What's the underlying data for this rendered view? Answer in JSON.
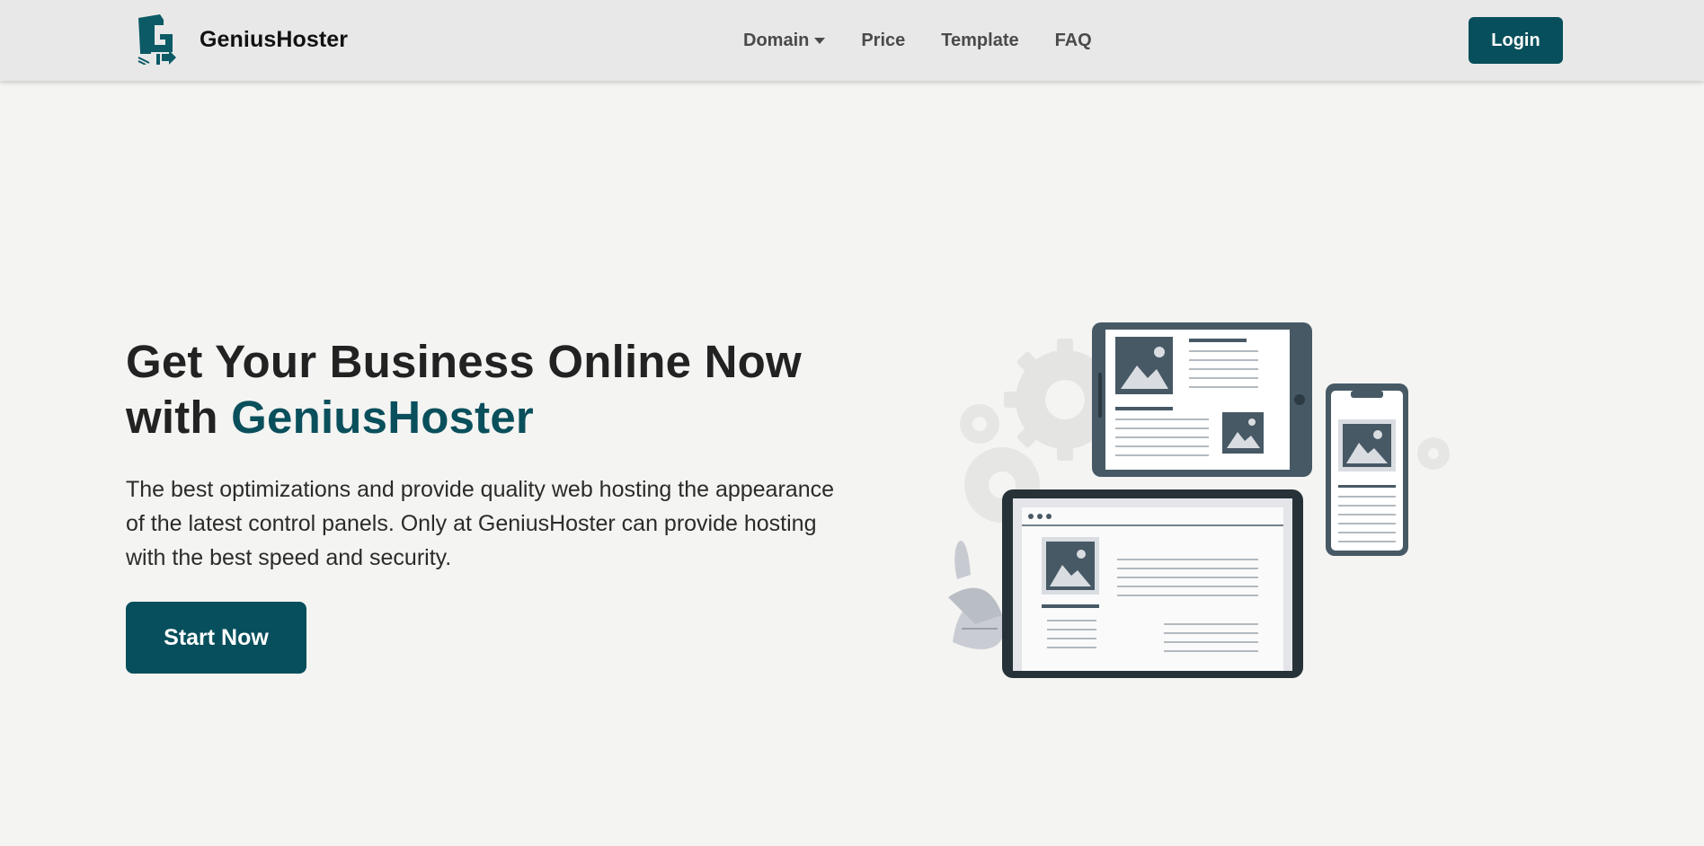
{
  "brand": {
    "name": "GeniusHoster"
  },
  "nav": {
    "items": [
      {
        "label": "Domain",
        "has_dropdown": true
      },
      {
        "label": "Price"
      },
      {
        "label": "Template"
      },
      {
        "label": "FAQ"
      }
    ],
    "login_label": "Login"
  },
  "hero": {
    "title_line1": "Get Your Business Online Now",
    "title_with": "with",
    "title_accent": "GeniusHoster",
    "description": "The best optimizations and provide quality web hosting the appearance of the latest control panels. Only at GeniusHoster can provide hosting with the best speed and security.",
    "cta_label": "Start Now"
  },
  "colors": {
    "accent": "#074f5c",
    "background": "#f4f4f2",
    "navbar": "#e8e8e8"
  },
  "icons": {
    "logo": "geniushoster-logo-icon",
    "dropdown": "caret-down-icon"
  }
}
